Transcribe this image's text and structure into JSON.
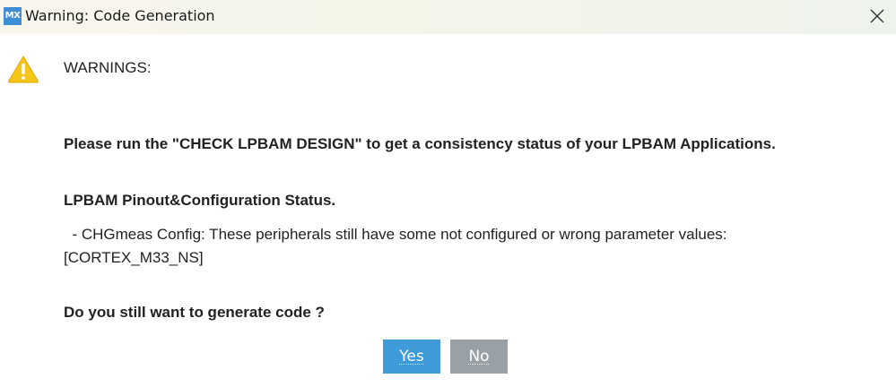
{
  "window": {
    "logo_text": "MX",
    "title": "Warning: Code Generation",
    "close_icon": "close-icon"
  },
  "content": {
    "icon": "warning-triangle-icon",
    "heading": "WARNINGS:",
    "run_check_message": "Please run the \"CHECK LPBAM DESIGN\" to get a consistency status of your LPBAM Applications.",
    "status_heading": "LPBAM Pinout&Configuration Status.",
    "status_detail_line1": "  - CHGmeas Config: These peripherals still have some not configured or wrong parameter values:",
    "status_detail_line2": "[CORTEX_M33_NS]",
    "question": "Do you still want to generate code ?"
  },
  "buttons": {
    "yes_label": "Yes",
    "no_label": "No",
    "yes_color": "#3e9bd7",
    "no_color": "#9aa1a6"
  }
}
